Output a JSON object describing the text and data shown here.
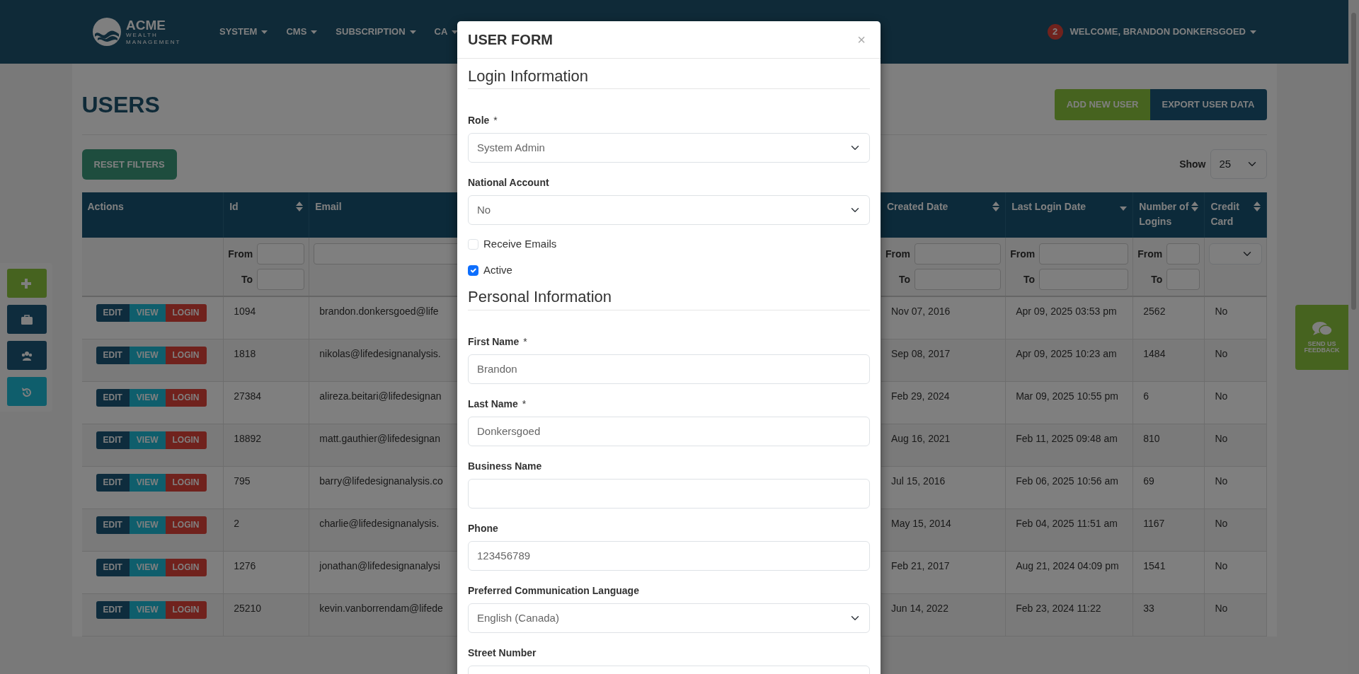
{
  "navbar": {
    "logo": {
      "name": "ACME",
      "tagline": "WEALTH MANAGEMENT"
    },
    "menu": [
      {
        "label": "SYSTEM"
      },
      {
        "label": "CMS"
      },
      {
        "label": "SUBSCRIPTION"
      },
      {
        "label": "CA"
      }
    ],
    "notification_count": "2",
    "user_menu": "WELCOME, BRANDON DONKERSGOED"
  },
  "page": {
    "title": "USERS",
    "buttons": [
      {
        "label": "ADD NEW USER",
        "kind": "success"
      },
      {
        "label": "EXPORT USER DATA",
        "kind": "primary"
      }
    ],
    "reset_button": "RESET FILTERS",
    "show_label": "Show",
    "show_value": "25"
  },
  "table": {
    "actions_column": {
      "label": "Actions"
    },
    "columns": [
      {
        "label": "Id",
        "sortable": true,
        "sorted_desc": false,
        "filter": {
          "kind": "range",
          "from_label": "From",
          "to_label": "To"
        }
      },
      {
        "label": "Email",
        "sortable": false,
        "filter": {
          "kind": "text"
        }
      },
      {
        "label": "Created Date",
        "sortable": true,
        "sorted_desc": false,
        "filter": {
          "kind": "range",
          "from_label": "From",
          "to_label": "To"
        }
      },
      {
        "label": "Last Login Date",
        "sortable": true,
        "sorted_desc": true,
        "filter": {
          "kind": "range",
          "from_label": "From",
          "to_label": "To"
        }
      },
      {
        "label": "Number of Logins",
        "sortable": true,
        "sorted_desc": false,
        "filter": {
          "kind": "range",
          "from_label": "From",
          "to_label": "To"
        }
      },
      {
        "label": "Credit Card",
        "sortable": true,
        "sorted_desc": false,
        "filter": {
          "kind": "select"
        }
      }
    ],
    "rows": [
      {
        "actions": [
          "EDIT",
          "VIEW",
          "LOGIN"
        ],
        "cells": [
          "1094",
          "brandon.donkersgoed@life",
          "Nov 07, 2016",
          "Apr 09, 2025 03:53 pm",
          "2562",
          "No"
        ]
      },
      {
        "actions": [
          "EDIT",
          "VIEW",
          "LOGIN"
        ],
        "cells": [
          "1818",
          "nikolas@lifedesignanalysis.",
          "Sep 08, 2017",
          "Apr 09, 2025 10:23 am",
          "1484",
          "No"
        ]
      },
      {
        "actions": [
          "EDIT",
          "VIEW",
          "LOGIN"
        ],
        "cells": [
          "27384",
          "alireza.beitari@lifedesignan",
          "Feb 29, 2024",
          "Mar 09, 2025 10:55 pm",
          "6",
          "No"
        ]
      },
      {
        "actions": [
          "EDIT",
          "VIEW",
          "LOGIN"
        ],
        "cells": [
          "18892",
          "matt.gauthier@lifedesignan",
          "Aug 16, 2021",
          "Feb 11, 2025 09:48 am",
          "810",
          "No"
        ]
      },
      {
        "actions": [
          "EDIT",
          "VIEW",
          "LOGIN"
        ],
        "cells": [
          "795",
          "barry@lifedesignanalysis.co",
          "Jul 15, 2016",
          "Feb 06, 2025 10:56 am",
          "69",
          "No"
        ]
      },
      {
        "actions": [
          "EDIT",
          "VIEW",
          "LOGIN"
        ],
        "cells": [
          "2",
          "charlie@lifedesignanalysis.",
          "May 15, 2014",
          "Feb 04, 2025 11:51 am",
          "1167",
          "No"
        ]
      },
      {
        "actions": [
          "EDIT",
          "VIEW",
          "LOGIN"
        ],
        "cells": [
          "1276",
          "jonathan@lifedesignanalysi",
          "Feb 21, 2017",
          "Aug 21, 2024 04:09 pm",
          "1541",
          "No"
        ]
      },
      {
        "actions": [
          "EDIT",
          "VIEW",
          "LOGIN"
        ],
        "cells": [
          "25210",
          "kevin.vanborrendam@lifede",
          "Jun 14, 2022",
          "Feb 23, 2024 11:22",
          "33",
          "No"
        ]
      }
    ]
  },
  "feedback_tab": {
    "label": "SEND US FEEDBACK"
  },
  "modal": {
    "title": "USER FORM",
    "close": "×",
    "sections": [
      {
        "heading": "Login Information",
        "fields": [
          {
            "kind": "select",
            "label": "Role",
            "required_mark": "*",
            "value": "System Admin"
          },
          {
            "kind": "select",
            "label": "National Account",
            "value": "No"
          },
          {
            "kind": "checkbox",
            "label": "Receive Emails",
            "checked": false
          },
          {
            "kind": "checkbox",
            "label": "Active",
            "checked": true
          }
        ]
      },
      {
        "heading": "Personal Information",
        "fields": [
          {
            "kind": "text",
            "label": "First Name",
            "required_mark": "*",
            "value": "Brandon"
          },
          {
            "kind": "text",
            "label": "Last Name",
            "required_mark": "*",
            "value": "Donkersgoed"
          },
          {
            "kind": "text",
            "label": "Business Name"
          },
          {
            "kind": "text",
            "label": "Phone",
            "value": "123456789"
          },
          {
            "kind": "select",
            "label": "Preferred Communication Language",
            "value": "English (Canada)"
          },
          {
            "kind": "text",
            "label": "Street Number"
          }
        ]
      }
    ]
  }
}
